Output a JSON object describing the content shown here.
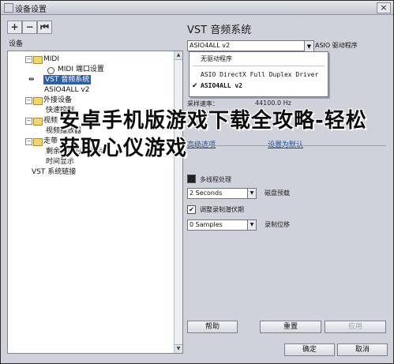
{
  "window": {
    "title": "设备设置",
    "close_glyph": "×"
  },
  "toolbar": {
    "add": "+",
    "remove": "−",
    "reset": "⏮"
  },
  "tree": {
    "header": "设备",
    "items": [
      {
        "label": "MIDI",
        "type": "folder",
        "expander": "−"
      },
      {
        "label": "MIDI 端口设置",
        "type": "node"
      },
      {
        "label": "VST 音频系统",
        "type": "device",
        "selected": true
      },
      {
        "label": "ASIO4ALL v2",
        "type": "leaf"
      },
      {
        "label": "外接设备",
        "type": "folder",
        "expander": "−"
      },
      {
        "label": "快速控制",
        "type": "leaf"
      },
      {
        "label": "视频",
        "type": "folder",
        "expander": "−"
      },
      {
        "label": "视频播放器",
        "type": "leaf"
      },
      {
        "label": "走带",
        "type": "folder",
        "expander": "−"
      },
      {
        "label": "剩余录制时间显示",
        "type": "leaf"
      },
      {
        "label": "时间显示",
        "type": "leaf"
      },
      {
        "label": "VST 系统链接",
        "type": "leaf"
      }
    ]
  },
  "panel": {
    "title": "VST 音频系统",
    "driver_value": "ASIO4ALL v2",
    "driver_label": "ASIO 驱动程序",
    "driver_menu": [
      {
        "label": "无驱动程序",
        "checked": false
      },
      {
        "label": "ASIO DirectX Full Duplex Driver",
        "checked": false
      },
      {
        "label": "ASIO4ALL v2",
        "checked": true
      }
    ],
    "sample_rate_label": "采样速率：",
    "sample_rate_value": "44100.0 Hz",
    "tab_advanced": "高级选项",
    "tab_defaults": "设置为默认",
    "multithread_label": "多线程处理",
    "preload_value": "2 Seconds",
    "preload_label": "磁盘预载",
    "adjust_latency_label": "调整录制潜伏期",
    "offset_value": "0 Samples",
    "offset_label": "录制位移",
    "help_button": "帮助",
    "reset_button": "重置",
    "apply_button": "应用"
  },
  "footer": {
    "ok_button": "确定",
    "cancel_button": "取消"
  },
  "overlay": {
    "text": "安卓手机版游戏下载全攻略-轻松获取心仪游戏"
  }
}
